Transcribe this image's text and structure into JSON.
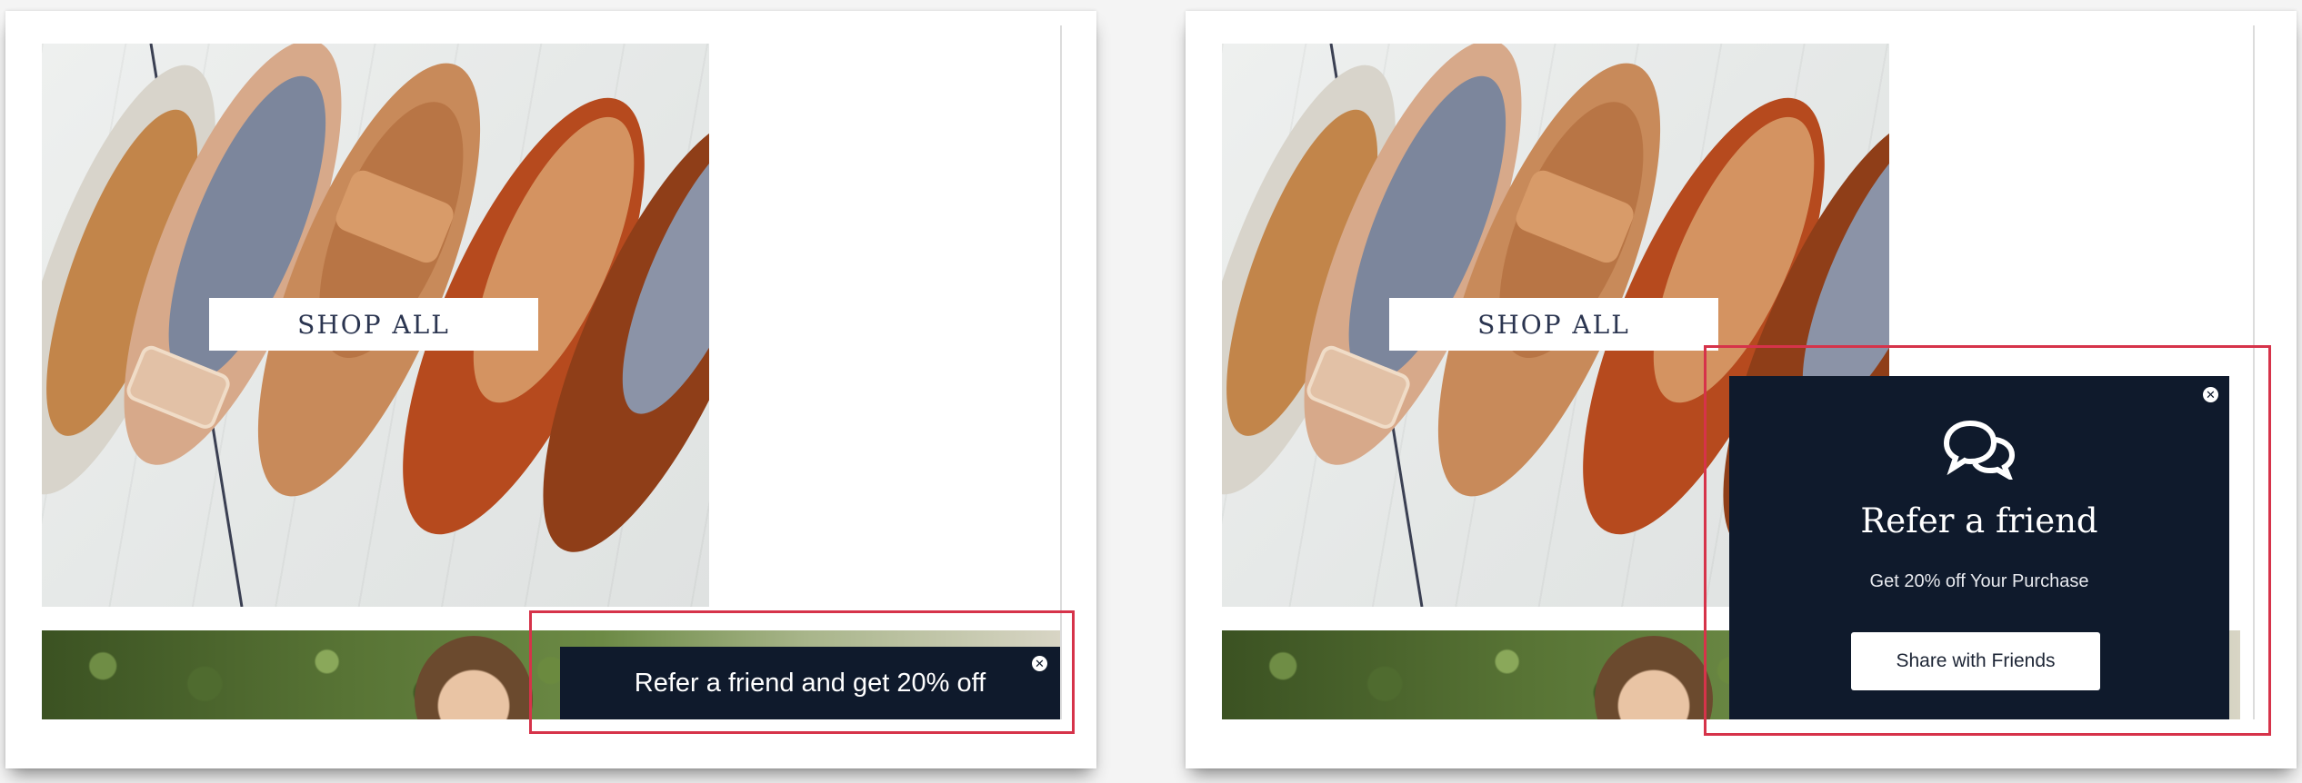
{
  "left_panel": {
    "shop_button_label": "SHOP ALL",
    "banner": {
      "text": "Refer a friend and get 20% off",
      "close_icon": "close-icon"
    }
  },
  "right_panel": {
    "shop_button_label": "SHOP ALL",
    "popup": {
      "icon": "chat-bubbles-icon",
      "title": "Refer a friend",
      "subtitle": "Get 20% off Your Purchase",
      "button_label": "Share with Friends",
      "close_icon": "close-icon"
    }
  },
  "colors": {
    "popup_background": "#0f1a2c",
    "highlight_border": "#d6334a",
    "button_text": "#2b3550"
  }
}
